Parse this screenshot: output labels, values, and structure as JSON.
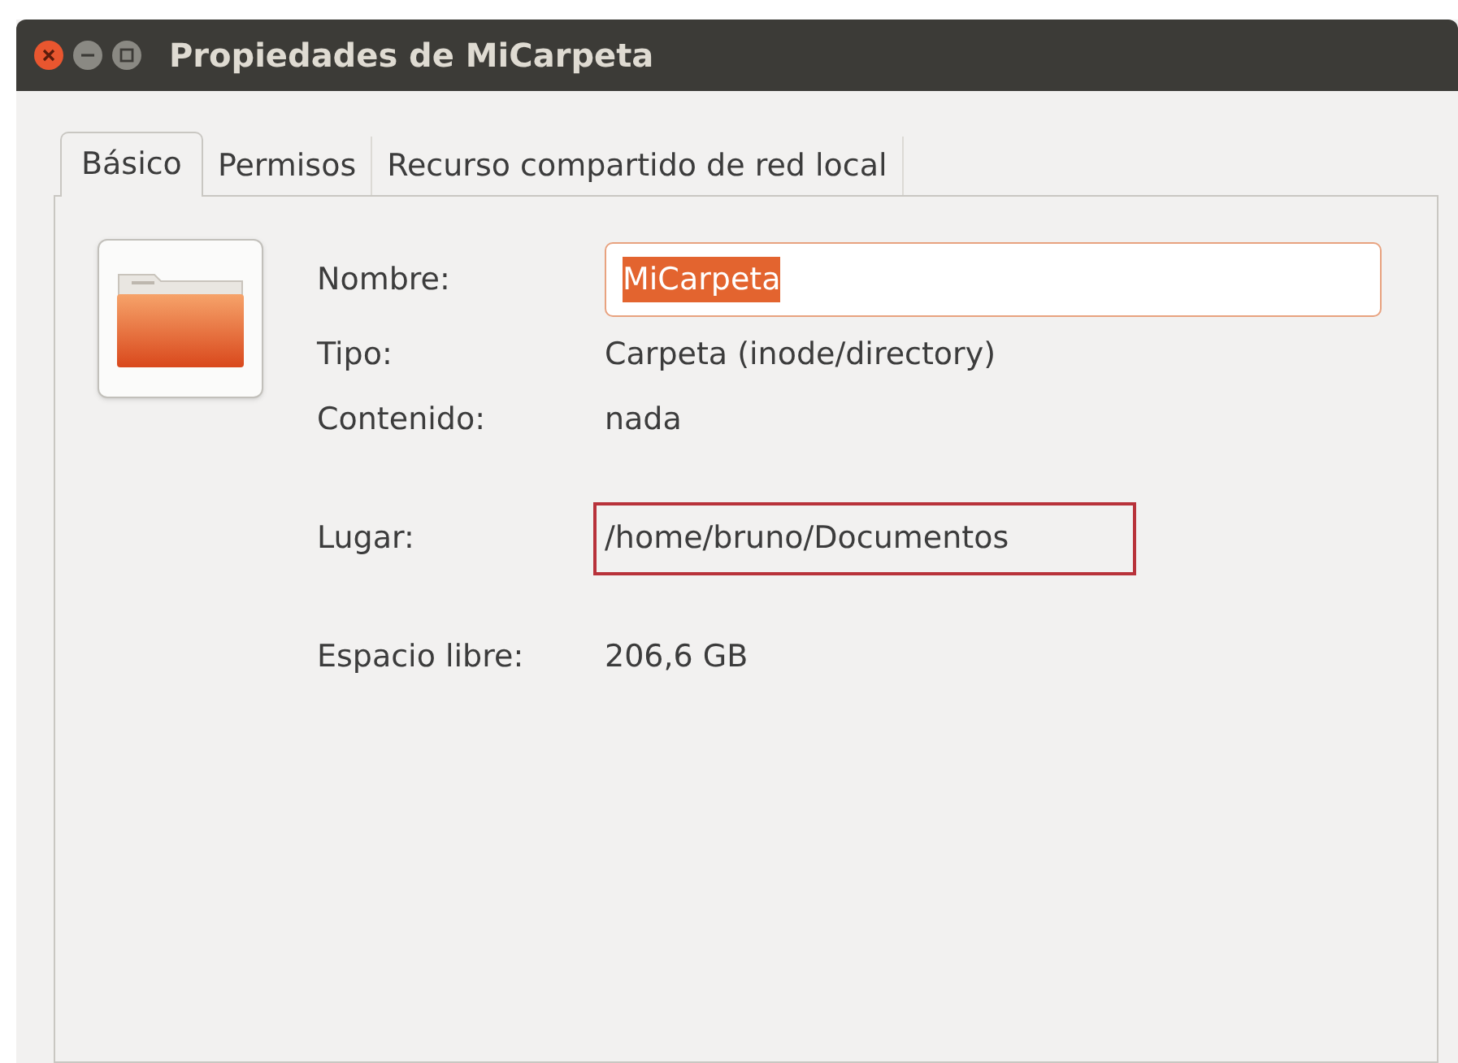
{
  "window": {
    "title": "Propiedades de MiCarpeta"
  },
  "tabs": [
    {
      "label": "Básico",
      "selected": true
    },
    {
      "label": "Permisos",
      "selected": false
    },
    {
      "label": "Recurso compartido de red local",
      "selected": false
    }
  ],
  "groups": [
    {
      "rows": [
        {
          "kind": "entry",
          "label": "Nombre:",
          "value": "MiCarpeta",
          "text_selected": true
        },
        {
          "kind": "text",
          "label": "Tipo:",
          "value": "Carpeta (inode/directory)",
          "highlighted": false
        },
        {
          "kind": "text",
          "label": "Contenido:",
          "value": "nada",
          "highlighted": false
        }
      ]
    },
    {
      "rows": [
        {
          "kind": "text",
          "label": "Lugar:",
          "value": "/home/bruno/Documentos",
          "highlighted": true
        }
      ]
    },
    {
      "rows": [
        {
          "kind": "text",
          "label": "Espacio libre:",
          "value": "206,6 GB",
          "highlighted": false
        }
      ]
    }
  ]
}
